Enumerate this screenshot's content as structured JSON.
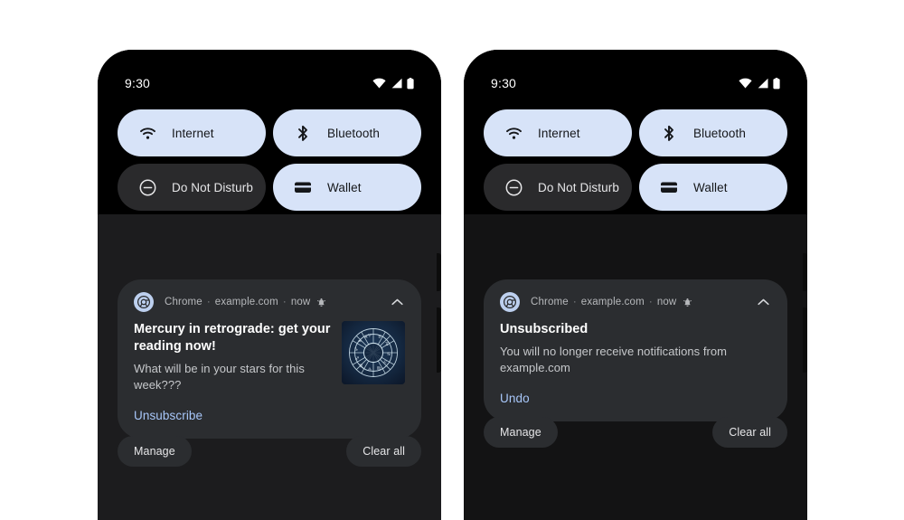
{
  "theme": {
    "page_bg": "#ffffff",
    "phone_bg": "#000000",
    "tile_on_bg": "#d7e3f8",
    "tile_off_bg": "#2a2a2c",
    "card_bg": "#2b2d30",
    "accent_link": "#a8c7fa",
    "shade_bg": "#1c1c1e",
    "text_primary": "#ffffff",
    "text_secondary": "#c6c8cb",
    "text_meta": "#b6b8bb"
  },
  "phones": [
    {
      "id": "before",
      "status_bar": {
        "time": "9:30",
        "icons": [
          "wifi-icon",
          "cellular-signal-icon",
          "battery-icon"
        ]
      },
      "quick_settings": {
        "tiles": [
          {
            "label": "Internet",
            "icon": "wifi-icon",
            "state": "on"
          },
          {
            "label": "Bluetooth",
            "icon": "bluetooth-icon",
            "state": "on"
          },
          {
            "label": "Do Not Disturb",
            "icon": "do-not-disturb-icon",
            "state": "off"
          },
          {
            "label": "Wallet",
            "icon": "wallet-icon",
            "state": "on"
          }
        ]
      },
      "notification": {
        "app_name": "Chrome",
        "app_icon": "chrome-icon",
        "source": "example.com",
        "time": "now",
        "alert_icon": "bell-icon",
        "separator": "·",
        "expand_icon": "chevron-up-icon",
        "title": "Mercury in retrograde: get your reading now!",
        "body": "What will be in your stars for this week???",
        "action_label": "Unsubscribe",
        "thumbnail": "zodiac-wheel-image",
        "has_thumbnail": true
      },
      "footer": {
        "manage_label": "Manage",
        "clear_all_label": "Clear all"
      }
    },
    {
      "id": "after",
      "status_bar": {
        "time": "9:30",
        "icons": [
          "wifi-icon",
          "cellular-signal-icon",
          "battery-icon"
        ]
      },
      "quick_settings": {
        "tiles": [
          {
            "label": "Internet",
            "icon": "wifi-icon",
            "state": "on"
          },
          {
            "label": "Bluetooth",
            "icon": "bluetooth-icon",
            "state": "on"
          },
          {
            "label": "Do Not Disturb",
            "icon": "do-not-disturb-icon",
            "state": "off"
          },
          {
            "label": "Wallet",
            "icon": "wallet-icon",
            "state": "on"
          }
        ]
      },
      "notification": {
        "app_name": "Chrome",
        "app_icon": "chrome-icon",
        "source": "example.com",
        "time": "now",
        "alert_icon": "bell-icon",
        "separator": "·",
        "expand_icon": "chevron-up-icon",
        "title": "Unsubscribed",
        "body": "You will no longer receive notifications from example.com",
        "action_label": "Undo",
        "thumbnail": null,
        "has_thumbnail": false
      },
      "footer": {
        "manage_label": "Manage",
        "clear_all_label": "Clear all"
      }
    }
  ]
}
